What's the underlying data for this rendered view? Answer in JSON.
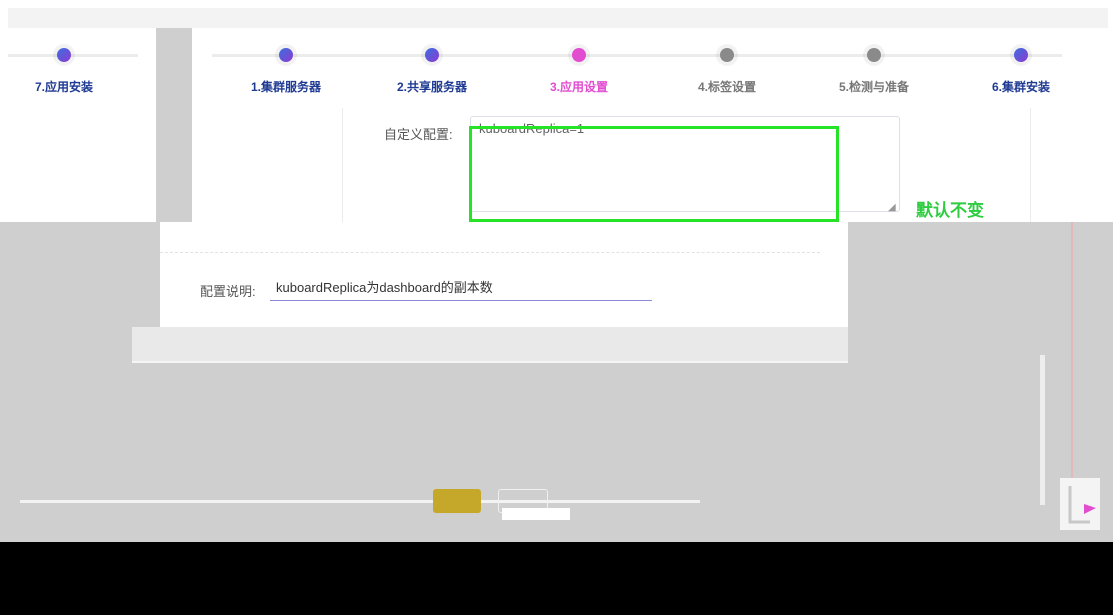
{
  "colors": {
    "step_active": "#e24dd0",
    "step_done_start": "#3b6fe0",
    "step_done_end": "#8d3bd0",
    "step_pending": "#8a8a8a",
    "highlight_green": "#27e327",
    "note_green": "#2ecc40",
    "label_done": "#1f3a93",
    "label_active": "#e24dd0",
    "label_pending": "#777777"
  },
  "steps_left": [
    {
      "label": "7.应用安装",
      "state": "done"
    }
  ],
  "steps": [
    {
      "label": "1.集群服务器",
      "state": "done"
    },
    {
      "label": "2.共享服务器",
      "state": "done"
    },
    {
      "label": "3.应用设置",
      "state": "active"
    },
    {
      "label": "4.标签设置",
      "state": "pending"
    },
    {
      "label": "5.检测与准备",
      "state": "pending"
    },
    {
      "label": "6.集群安装",
      "state": "done"
    }
  ],
  "form": {
    "custom_config_label": "自定义配置:",
    "custom_config_value": "kuboardReplica=1",
    "default_note": "默认不变",
    "description_label": "配置说明:",
    "description_value": "kuboardReplica为dashboard的副本数"
  }
}
